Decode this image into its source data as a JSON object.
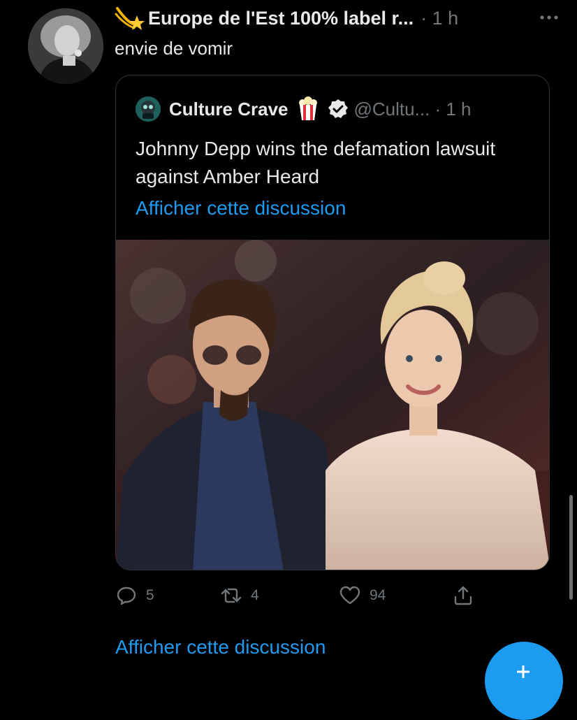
{
  "tweet": {
    "author_name": "Europe de l'Est 100% label r...",
    "time": "· 1 h",
    "text": "envie de vomir",
    "avatar_icon": "profile-photo-bw"
  },
  "quoted": {
    "author_name": "Culture Crave",
    "handle": "@Cultu... · 1 h",
    "text": "Johnny Depp wins the defamation lawsuit against Amber Heard",
    "show_thread": "Afficher cette discussion",
    "media_icon": "photo-couple-red-carpet"
  },
  "actions": {
    "reply_count": "5",
    "retweet_count": "4",
    "like_count": "94"
  },
  "show_thread": "Afficher cette discussion",
  "colors": {
    "background": "#000000",
    "link": "#1d9bf0",
    "muted": "#71767b",
    "text": "#e7e9ea",
    "border": "#2f3336"
  }
}
